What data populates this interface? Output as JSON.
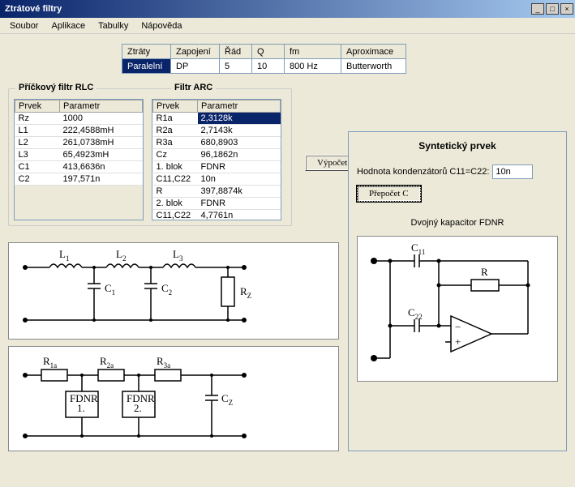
{
  "window": {
    "title": "Ztrátové filtry"
  },
  "menu": {
    "soubor": "Soubor",
    "aplikace": "Aplikace",
    "tabulky": "Tabulky",
    "napoveda": "Nápověda"
  },
  "topTable": {
    "headers": {
      "ztraty": "Ztráty",
      "zapojeni": "Zapojení",
      "rad": "Řád",
      "q": "Q",
      "fm": "fm",
      "aprox": "Aproximace"
    },
    "row": {
      "ztraty": "Paralelní",
      "zapojeni": "DP",
      "rad": "5",
      "q": "10",
      "fm": "800 Hz",
      "aprox": "Butterworth"
    }
  },
  "groupTitles": {
    "rlc": "Příčkový filtr RLC",
    "arc": "Filtr ARC"
  },
  "rlc": {
    "headers": {
      "prvek": "Prvek",
      "param": "Parametr"
    },
    "rows": [
      {
        "p": "Rz",
        "v": "1000"
      },
      {
        "p": "L1",
        "v": "222,4588mH"
      },
      {
        "p": "L2",
        "v": "261,0738mH"
      },
      {
        "p": "L3",
        "v": "65,4923mH"
      },
      {
        "p": "C1",
        "v": "413,6636n"
      },
      {
        "p": "C2",
        "v": "197,571n"
      }
    ]
  },
  "arc": {
    "headers": {
      "prvek": "Prvek",
      "param": "Parametr"
    },
    "rows": [
      {
        "p": "R1a",
        "v": "2,3128k",
        "sel": true
      },
      {
        "p": "R2a",
        "v": "2,7143k"
      },
      {
        "p": "R3a",
        "v": "680,8903"
      },
      {
        "p": "Cz",
        "v": "96,1862n"
      },
      {
        "p": "1. blok",
        "v": "FDNR"
      },
      {
        "p": "C11,C22",
        "v": "10n"
      },
      {
        "p": "R",
        "v": "397,8874k"
      },
      {
        "p": "2. blok",
        "v": "FDNR"
      },
      {
        "p": "C11,C22",
        "v": "4,7761n"
      }
    ]
  },
  "buttons": {
    "vypocet": "Výpočet",
    "prepocet": "Přepočet C"
  },
  "right": {
    "title": "Syntetický prvek",
    "capLabel": "Hodnota kondenzátorů C11=C22:",
    "capValue": "10n",
    "diagTitle": "Dvojný kapacitor FDNR"
  },
  "circuit1": {
    "L1": "L",
    "L1s": "1",
    "L2": "L",
    "L2s": "2",
    "L3": "L",
    "L3s": "3",
    "C1": "C",
    "C1s": "1",
    "C2": "C",
    "C2s": "2",
    "Rz": "R",
    "Rzs": "Z"
  },
  "circuit2": {
    "R1": "R",
    "R1s": "1a",
    "R2": "R",
    "R2s": "2a",
    "R3": "R",
    "R3s": "3a",
    "F1a": "FDNR",
    "F1b": "1.",
    "F2a": "FDNR",
    "F2b": "2.",
    "Cz": "C",
    "Czs": "Z"
  },
  "circuit3": {
    "C11": "C",
    "C11s": "11",
    "C22": "C",
    "C22s": "22",
    "R": "R"
  }
}
